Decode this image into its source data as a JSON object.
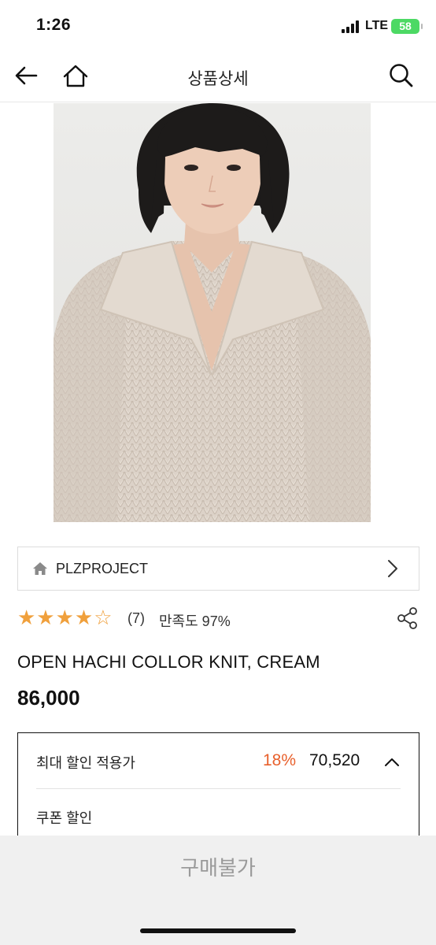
{
  "status_bar": {
    "time": "1:26",
    "network": "LTE",
    "battery": "58"
  },
  "nav": {
    "title": "상품상세",
    "back_icon": "arrow-left-icon",
    "home_icon": "home-icon",
    "search_icon": "search-icon"
  },
  "hero": {
    "subject": "model wearing cream open collar knit sweater"
  },
  "brand": {
    "name": "PLZPROJECT",
    "icon": "home-icon",
    "chevron": "chevron-right-icon"
  },
  "rating": {
    "stars_display": "★★★★☆",
    "rating_value": 4,
    "rating_max": 5,
    "review_count": "(7)",
    "satisfaction": "만족도 97%",
    "share_icon": "share-icon",
    "star_color": "#f0a03c"
  },
  "product": {
    "name": "OPEN HACHI COLLOR KNIT, CREAM",
    "price": "86,000"
  },
  "discount": {
    "label": "최대 할인 적용가",
    "rate": "18%",
    "price": "70,520",
    "rate_color": "#e8602c",
    "chevron": "chevron-up-icon",
    "coupon_label": "쿠폰 할인"
  },
  "buy": {
    "label": "구매불가"
  }
}
